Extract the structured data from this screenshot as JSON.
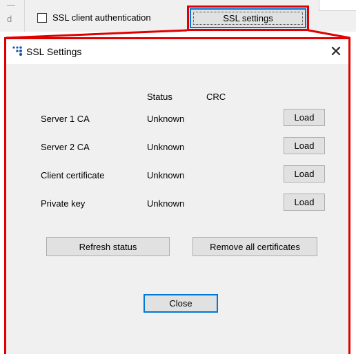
{
  "parent": {
    "left_stub_letter": "d",
    "ssl_client_auth_label": "SSL client authentication",
    "ssl_client_auth_checked": false,
    "ssl_settings_button": "SSL settings"
  },
  "dialog": {
    "title": "SSL Settings",
    "close_glyph": "✕",
    "columns": {
      "status": "Status",
      "crc": "CRC"
    },
    "rows": [
      {
        "label": "Server 1 CA",
        "status": "Unknown",
        "crc": "",
        "load": "Load"
      },
      {
        "label": "Server 2 CA",
        "status": "Unknown",
        "crc": "",
        "load": "Load"
      },
      {
        "label": "Client certificate",
        "status": "Unknown",
        "crc": "",
        "load": "Load"
      },
      {
        "label": "Private key",
        "status": "Unknown",
        "crc": "",
        "load": "Load"
      }
    ],
    "refresh_button": "Refresh status",
    "remove_button": "Remove all certificates",
    "close_button": "Close"
  },
  "colors": {
    "highlight": "#e00000",
    "focus_border": "#0078d7",
    "dialog_bg": "#f0f0f0",
    "button_bg": "#e1e1e1",
    "icon_blue": "#1e5aa8"
  },
  "icons": {
    "app": "app-logo-icon",
    "close": "close-icon"
  }
}
